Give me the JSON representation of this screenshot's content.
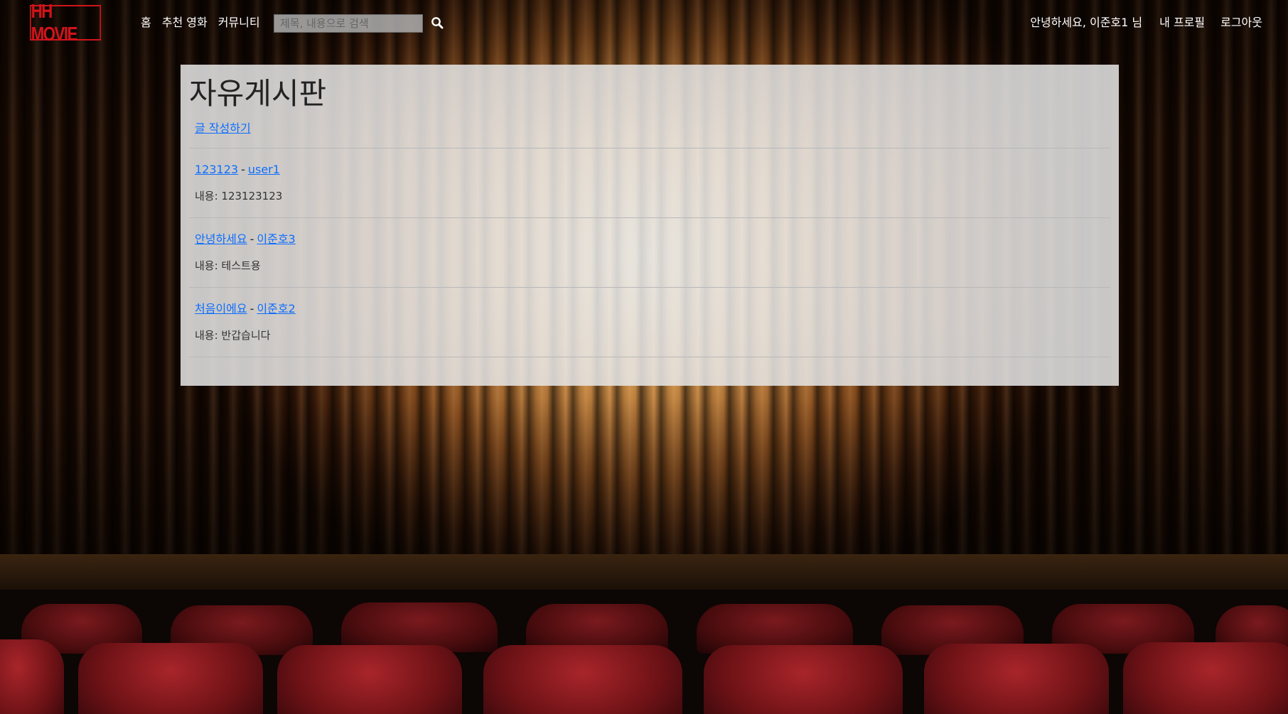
{
  "nav": {
    "logo_text": "HH MOVIE",
    "links": [
      "홈",
      "추천 영화",
      "커뮤니티"
    ],
    "search_placeholder": "제목, 내용으로 검색",
    "search_icon": "search-icon",
    "greeting": "안녕하세요, 이준호1 님",
    "profile_label": "내 프로필",
    "logout_label": "로그아웃"
  },
  "board": {
    "title": "자유게시판",
    "write_label": "글 작성하기",
    "separator": "-",
    "posts": [
      {
        "title": "123123",
        "author": "user1",
        "content": "내용: 123123123"
      },
      {
        "title": "안녕하세요",
        "author": "이준호3",
        "content": "내용: 테스트용"
      },
      {
        "title": "처음이에요",
        "author": "이준호2",
        "content": "내용: 반갑습니다"
      }
    ]
  },
  "colors": {
    "logo_red": "#d0141b",
    "link_blue": "#0d6efd",
    "panel_bg": "#e6e6e6"
  }
}
